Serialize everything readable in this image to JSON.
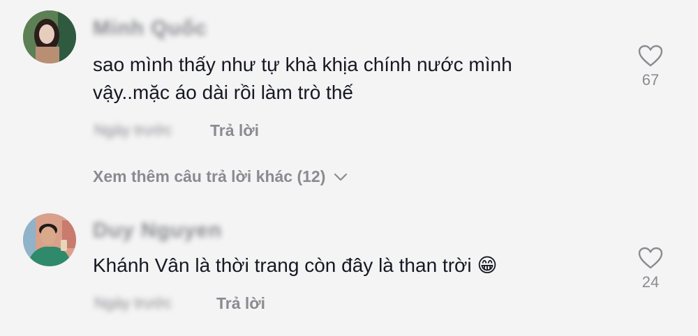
{
  "comments": [
    {
      "username": "Minh Quốc",
      "text_line1": "sao mình thấy như tự khà khịa chính nước mình",
      "text_line2": "vậy..mặc áo dài rồi làm trò thế",
      "date": "Ngày trước",
      "reply_label": "Trả lời",
      "like_count": "67"
    },
    {
      "username": "Duy Nguyen",
      "text": "Khánh Vân là thời trang còn đây là than trời 😁",
      "date": "Ngày trước",
      "reply_label": "Trả lời",
      "like_count": "24"
    }
  ],
  "view_more_label": "Xem thêm câu trả lời khác (12)",
  "icons": {
    "like": "heart-outline-icon",
    "expand": "chevron-down-icon"
  }
}
